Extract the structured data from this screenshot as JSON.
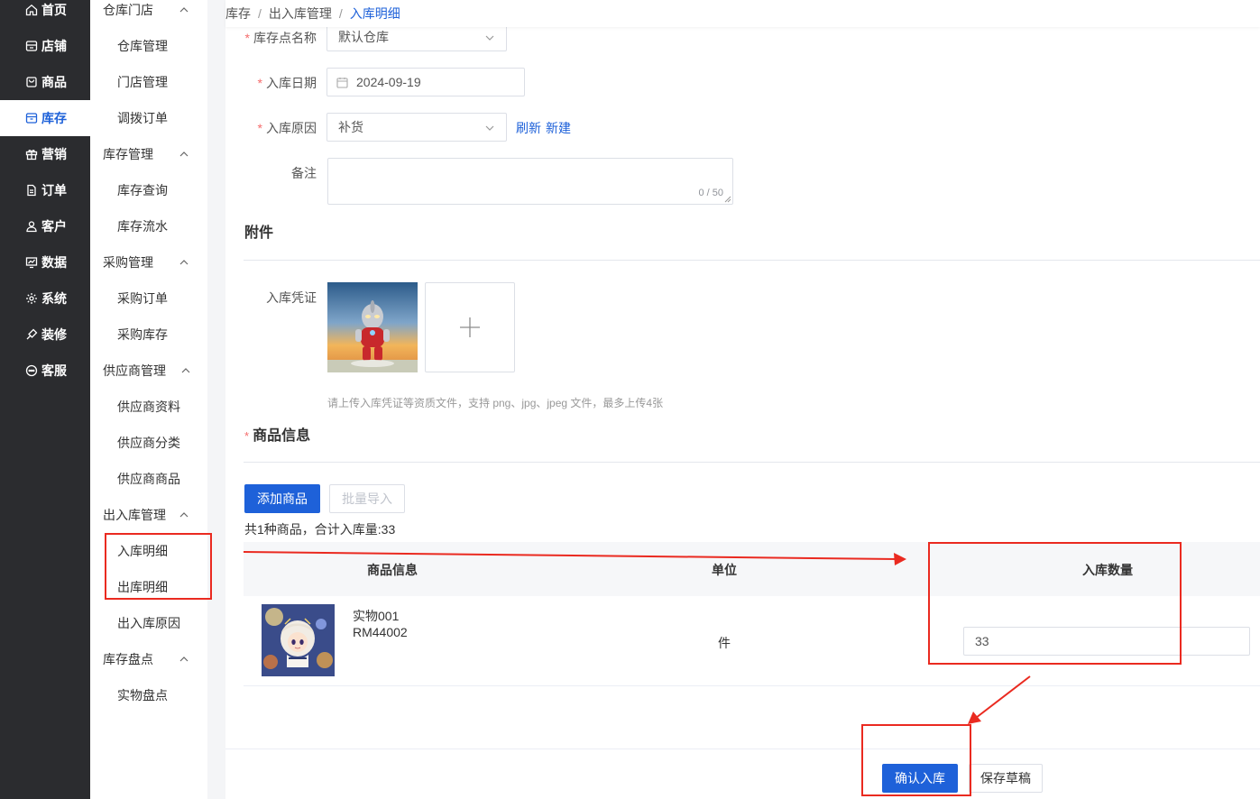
{
  "primary_nav": [
    {
      "label": "首页",
      "icon": "home-icon",
      "active": false
    },
    {
      "label": "店铺",
      "icon": "shop-icon",
      "active": false
    },
    {
      "label": "商品",
      "icon": "bag-icon",
      "active": false
    },
    {
      "label": "库存",
      "icon": "warehouse-icon",
      "active": true
    },
    {
      "label": "营销",
      "icon": "gift-icon",
      "active": false
    },
    {
      "label": "订单",
      "icon": "document-icon",
      "active": false
    },
    {
      "label": "客户",
      "icon": "users-icon",
      "active": false
    },
    {
      "label": "数据",
      "icon": "chart-icon",
      "active": false
    },
    {
      "label": "系统",
      "icon": "gear-icon",
      "active": false
    },
    {
      "label": "装修",
      "icon": "brush-icon",
      "active": false
    },
    {
      "label": "客服",
      "icon": "chat-icon",
      "active": false
    }
  ],
  "secondary_nav": [
    {
      "type": "group",
      "label": "仓库门店"
    },
    {
      "type": "item",
      "label": "仓库管理"
    },
    {
      "type": "item",
      "label": "门店管理"
    },
    {
      "type": "item",
      "label": "调拨订单"
    },
    {
      "type": "group",
      "label": "库存管理"
    },
    {
      "type": "item",
      "label": "库存查询"
    },
    {
      "type": "item",
      "label": "库存流水"
    },
    {
      "type": "group",
      "label": "采购管理"
    },
    {
      "type": "item",
      "label": "采购订单"
    },
    {
      "type": "item",
      "label": "采购库存"
    },
    {
      "type": "group",
      "label": "供应商管理"
    },
    {
      "type": "item",
      "label": "供应商资料"
    },
    {
      "type": "item",
      "label": "供应商分类"
    },
    {
      "type": "item",
      "label": "供应商商品"
    },
    {
      "type": "group",
      "label": "出入库管理"
    },
    {
      "type": "item",
      "label": "入库明细"
    },
    {
      "type": "item",
      "label": "出库明细"
    },
    {
      "type": "item",
      "label": "出入库原因"
    },
    {
      "type": "group",
      "label": "库存盘点"
    },
    {
      "type": "item",
      "label": "实物盘点"
    }
  ],
  "breadcrumb": [
    "库存",
    "出入库管理",
    "入库明细"
  ],
  "form": {
    "warehouse_label": "库存点名称",
    "warehouse_value": "默认仓库",
    "date_label": "入库日期",
    "date_value": "2024-09-19",
    "reason_label": "入库原因",
    "reason_value": "补货",
    "refresh_link": "刷新",
    "new_link": "新建",
    "remark_label": "备注",
    "remark_count": "0 / 50"
  },
  "attachments": {
    "title": "附件",
    "voucher_label": "入库凭证",
    "hint": "请上传入库凭证等资质文件，支持 png、jpg、jpeg 文件，最多上传4张"
  },
  "products": {
    "title": "商品信息",
    "add_button": "添加商品",
    "import_button": "批量导入",
    "summary": "共1种商品，合计入库量:33",
    "columns": [
      "商品信息",
      "单位",
      "入库数量"
    ],
    "rows": [
      {
        "name": "实物001",
        "code": "RM44002",
        "unit": "件",
        "quantity": "33"
      }
    ]
  },
  "footer": {
    "confirm_button": "确认入库",
    "draft_button": "保存草稿"
  },
  "colors": {
    "accent": "#1e61d9",
    "sidebar_bg": "#2b2c2f",
    "annotation": "#ea2a20",
    "required": "#f56c6c"
  }
}
